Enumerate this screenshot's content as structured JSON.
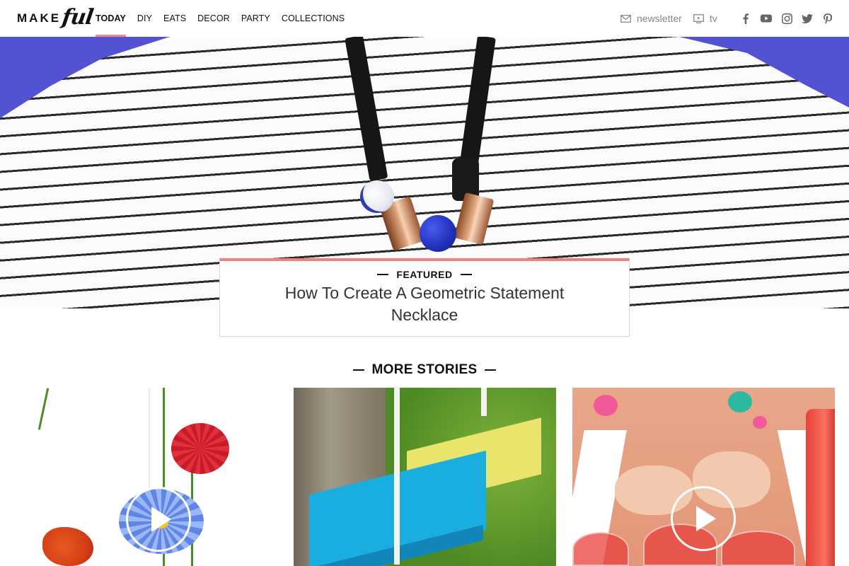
{
  "header": {
    "logo": {
      "make": "MAKE",
      "ful": "ful"
    },
    "nav": [
      {
        "label": "TODAY",
        "active": true
      },
      {
        "label": "DIY",
        "active": false
      },
      {
        "label": "EATS",
        "active": false
      },
      {
        "label": "DECOR",
        "active": false
      },
      {
        "label": "PARTY",
        "active": false
      },
      {
        "label": "COLLECTIONS",
        "active": false
      }
    ],
    "utility": [
      {
        "label": "newsletter",
        "icon": "mail-icon"
      },
      {
        "label": "tv",
        "icon": "tv-icon"
      }
    ],
    "social": [
      "facebook-icon",
      "youtube-icon",
      "instagram-icon",
      "twitter-icon",
      "pinterest-icon"
    ]
  },
  "hero": {
    "image": "striped-shirt-geometric-necklace"
  },
  "featured": {
    "label": "FEATURED",
    "title": "How To Create A Geometric Statement Necklace"
  },
  "more_stories": {
    "heading": "MORE STORIES",
    "cards": [
      {
        "image": "hanging-flowers",
        "has_video": true
      },
      {
        "image": "painted-swing",
        "has_video": false
      },
      {
        "image": "strawberry-drinks",
        "has_video": true
      }
    ]
  },
  "colors": {
    "accent": "#f08080",
    "hero_background": "#5352d2",
    "text": "#111111",
    "muted": "#888888"
  }
}
